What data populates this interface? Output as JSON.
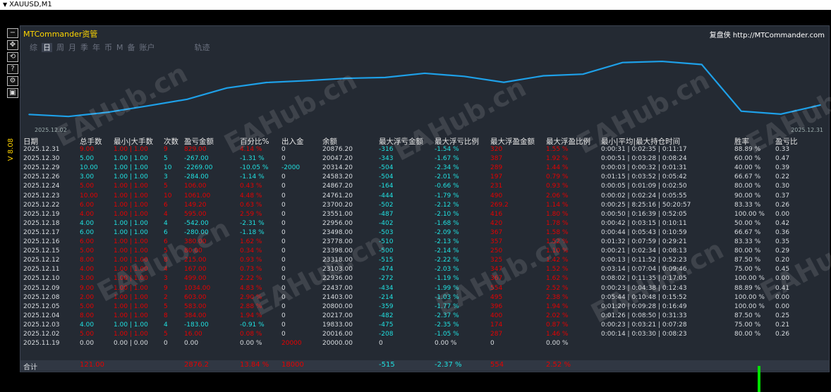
{
  "window": {
    "title": "XAUUSD,M1"
  },
  "panel": {
    "brand": "MTCommander资管",
    "brand_right": "复盘侠 http://MTCommander.com",
    "tabs": [
      "综",
      "日",
      "周",
      "月",
      "季",
      "年",
      "币",
      "M",
      "备",
      "账户"
    ],
    "tab_active": "日",
    "tab_extra": "轨迹",
    "chart_start": "2025.12.02",
    "chart_end": "2025.12.31",
    "vertical_label": "V 8.08"
  },
  "sidebar": {
    "icons": [
      "minimize-icon",
      "move-icon",
      "sync-icon",
      "help-icon",
      "settings-icon",
      "window-icon"
    ]
  },
  "colors": {
    "accent": "#ffd700",
    "line": "#1ea0e8",
    "positive": "#20e0e0",
    "negative": "#e60000",
    "panel_bg": "#242a33"
  },
  "watermark": "EAHub.cn",
  "table": {
    "headers": [
      "日期",
      "总手数",
      "最小|大手数",
      "次数",
      "盈亏金额",
      "百分比%",
      "出入金",
      "余额",
      "最大浮亏金额",
      "最大浮亏比例",
      "最大浮盈金额",
      "最大浮盈比例",
      "最小|平均|最大持仓时间",
      "胜率",
      "盈亏比"
    ],
    "rows": [
      [
        "2025.12.31",
        "9.00",
        "1.00 | 1.00",
        "9",
        "829.00",
        "4.14 %",
        "0",
        "20876.20",
        "-316",
        "-1.54 %",
        "320",
        "1.55 %",
        "0:00:31 | 0:02:35 | 0:11:17",
        "88.89 %",
        "0.33"
      ],
      [
        "2025.12.30",
        "5.00",
        "1.00 | 1.00",
        "5",
        "-267.00",
        "-1.31 %",
        "0",
        "20047.20",
        "-343",
        "-1.67 %",
        "387",
        "1.92 %",
        "0:00:51 | 0:03:28 | 0:08:24",
        "60.00 %",
        "0.47"
      ],
      [
        "2025.12.29",
        "10.00",
        "1.00 | 1.00",
        "10",
        "-2269.00",
        "-10.05 %",
        "-2000",
        "20314.20",
        "-504",
        "-2.34 %",
        "289",
        "1.44 %",
        "0:00:03 | 0:00:32 | 0:01:31",
        "40.00 %",
        "0.39"
      ],
      [
        "2025.12.26",
        "3.00",
        "1.00 | 1.00",
        "3",
        "-284.00",
        "-1.14 %",
        "0",
        "24583.20",
        "-504",
        "-2.01 %",
        "197",
        "0.79 %",
        "0:01:15 | 0:03:52 | 0:05:42",
        "66.67 %",
        "0.22"
      ],
      [
        "2025.12.24",
        "5.00",
        "1.00 | 1.00",
        "5",
        "106.00",
        "0.43 %",
        "0",
        "24867.20",
        "-164",
        "-0.66 %",
        "231",
        "0.93 %",
        "0:00:05 | 0:01:09 | 0:02:50",
        "80.00 %",
        "0.30"
      ],
      [
        "2025.12.23",
        "10.00",
        "1.00 | 1.00",
        "10",
        "1061.00",
        "4.48 %",
        "0",
        "24761.20",
        "-444",
        "-1.79 %",
        "490",
        "2.06 %",
        "0:00:02 | 0:02:24 | 0:05:55",
        "90.00 %",
        "0.37"
      ],
      [
        "2025.12.22",
        "6.00",
        "1.00 | 1.00",
        "6",
        "149.20",
        "0.63 %",
        "0",
        "23700.20",
        "-502",
        "-2.12 %",
        "269.2",
        "1.14 %",
        "0:00:25 | 8:25:16 | 50:20:57",
        "83.33 %",
        "0.26"
      ],
      [
        "2025.12.19",
        "4.00",
        "1.00 | 1.00",
        "4",
        "595.00",
        "2.59 %",
        "0",
        "23551.00",
        "-487",
        "-2.10 %",
        "416",
        "1.80 %",
        "0:00:50 | 0:16:39 | 0:52:05",
        "100.00 %",
        "0.00"
      ],
      [
        "2025.12.18",
        "4.00",
        "1.00 | 1.00",
        "4",
        "-542.00",
        "-2.31 %",
        "0",
        "22956.00",
        "-402",
        "-1.68 %",
        "420",
        "1.78 %",
        "0:00:42 | 0:03:15 | 0:10:11",
        "50.00 %",
        "0.42"
      ],
      [
        "2025.12.17",
        "6.00",
        "1.00 | 1.00",
        "6",
        "-280.00",
        "-1.18 %",
        "0",
        "23498.00",
        "-503",
        "-2.09 %",
        "367",
        "1.58 %",
        "0:00:44 | 0:05:43 | 0:10:59",
        "66.67 %",
        "0.36"
      ],
      [
        "2025.12.16",
        "6.00",
        "1.00 | 1.00",
        "6",
        "380.00",
        "1.62 %",
        "0",
        "23778.00",
        "-510",
        "-2.13 %",
        "357",
        "1.52 %",
        "0:01:32 | 0:07:59 | 0:29:21",
        "83.33 %",
        "0.35"
      ],
      [
        "2025.12.15",
        "5.00",
        "1.00 | 1.00",
        "5",
        "80.00",
        "0.34 %",
        "0",
        "23398.00",
        "-500",
        "-2.14 %",
        "250",
        "1.10 %",
        "0:00:21 | 0:02:34 | 0:08:13",
        "80.00 %",
        "0.29"
      ],
      [
        "2025.12.12",
        "8.00",
        "1.00 | 1.00",
        "8",
        "215.00",
        "0.93 %",
        "0",
        "23318.00",
        "-515",
        "-2.22 %",
        "325",
        "1.42 %",
        "0:00:13 | 0:11:52 | 0:52:23",
        "87.50 %",
        "0.20"
      ],
      [
        "2025.12.11",
        "4.00",
        "1.00 | 1.00",
        "4",
        "167.00",
        "0.73 %",
        "0",
        "23103.00",
        "-474",
        "-2.03 %",
        "347",
        "1.52 %",
        "0:03:14 | 0:07:04 | 0:09:46",
        "75.00 %",
        "0.45"
      ],
      [
        "2025.12.10",
        "3.00",
        "1.00 | 1.00",
        "3",
        "499.00",
        "2.22 %",
        "0",
        "22936.00",
        "-272",
        "-1.19 %",
        "367",
        "1.62 %",
        "0:08:02 | 0:11:35 | 0:17:05",
        "100.00 %",
        "0.00"
      ],
      [
        "2025.12.09",
        "9.00",
        "1.00 | 1.00",
        "9",
        "1034.00",
        "4.83 %",
        "0",
        "22437.00",
        "-434",
        "-1.99 %",
        "554",
        "2.52 %",
        "0:00:23 | 0:04:38 | 0:12:43",
        "88.89 %",
        "0.41"
      ],
      [
        "2025.12.08",
        "2.00",
        "1.00 | 1.00",
        "2",
        "603.00",
        "2.90 %",
        "0",
        "21403.00",
        "-214",
        "-1.03 %",
        "495",
        "2.38 %",
        "0:05:44 | 0:10:48 | 0:15:52",
        "100.00 %",
        "0.00"
      ],
      [
        "2025.12.05",
        "5.00",
        "1.00 | 1.00",
        "5",
        "583.00",
        "2.88 %",
        "0",
        "20800.00",
        "-359",
        "-1.77 %",
        "396",
        "1.94 %",
        "0:01:20 | 0:09:28 | 0:16:49",
        "100.00 %",
        "0.00"
      ],
      [
        "2025.12.04",
        "8.00",
        "1.00 | 1.00",
        "8",
        "384.00",
        "1.94 %",
        "0",
        "20217.00",
        "-482",
        "-2.37 %",
        "400",
        "2.02 %",
        "0:01:26 | 0:08:50 | 0:31:33",
        "87.50 %",
        "0.25"
      ],
      [
        "2025.12.03",
        "4.00",
        "1.00 | 1.00",
        "4",
        "-183.00",
        "-0.91 %",
        "0",
        "19833.00",
        "-475",
        "-2.35 %",
        "174",
        "0.87 %",
        "0:00:23 | 0:03:21 | 0:07:28",
        "75.00 %",
        "0.21"
      ],
      [
        "2025.12.02",
        "5.00",
        "1.00 | 1.00",
        "5",
        "16.00",
        "0.08 %",
        "0",
        "20016.00",
        "-208",
        "-1.05 %",
        "287",
        "1.46 %",
        "0:00:14 | 0:03:30 | 0:08:23",
        "80.00 %",
        "0.26"
      ],
      [
        "2025.11.19",
        "0.00",
        "0.00 | 0.00",
        "0",
        "0.00",
        "0.00 %",
        "20000",
        "20000.00",
        "0",
        "0.00 %",
        "0",
        "0.00 %",
        "",
        "",
        ""
      ]
    ],
    "row_colors": [
      "red",
      "cyn",
      "cyn",
      "cyn",
      "red",
      "red",
      "red",
      "red",
      "cyn",
      "cyn",
      "red",
      "red",
      "red",
      "red",
      "red",
      "red",
      "red",
      "red",
      "red",
      "cyn",
      "red",
      "wht"
    ],
    "total": {
      "label": "合计",
      "lots": "121.00",
      "pnl": "2876.2",
      "pct": "13.84 %",
      "flow": "18000",
      "max_dd": "-515",
      "max_dd_pct": "-2.37 %",
      "max_fp": "554",
      "max_fp_pct": "2.52 %"
    }
  },
  "chart_data": {
    "type": "line",
    "x": [
      "2025.12.02",
      "2025.12.03",
      "2025.12.04",
      "2025.12.05",
      "2025.12.08",
      "2025.12.09",
      "2025.12.10",
      "2025.12.11",
      "2025.12.12",
      "2025.12.15",
      "2025.12.16",
      "2025.12.17",
      "2025.12.18",
      "2025.12.19",
      "2025.12.22",
      "2025.12.23",
      "2025.12.24",
      "2025.12.26",
      "2025.12.29",
      "2025.12.30",
      "2025.12.31"
    ],
    "series": [
      {
        "values": [
          20016.0,
          19833.0,
          20217.0,
          20800.0,
          21403.0,
          22437.0,
          22936.0,
          23103.0,
          23318.0,
          23398.0,
          23778.0,
          23498.0,
          22956.0,
          23551.0,
          23700.2,
          24761.2,
          24867.2,
          24583.2,
          20314.2,
          20047.2,
          20876.2
        ]
      }
    ]
  }
}
